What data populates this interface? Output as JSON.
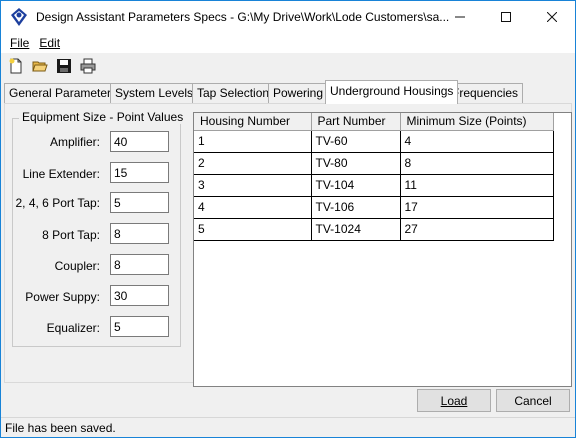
{
  "window": {
    "title": "Design Assistant Parameters Specs - G:\\My Drive\\Work\\Lode Customers\\sa..."
  },
  "menu": {
    "file_label": "File",
    "edit_label": "Edit"
  },
  "toolbar": {
    "icons": [
      "new-file-icon",
      "open-folder-icon",
      "save-disk-icon",
      "print-icon"
    ]
  },
  "tabs": [
    {
      "label": "General Parameters"
    },
    {
      "label": "System Levels"
    },
    {
      "label": "Tap Selection"
    },
    {
      "label": "Powering"
    },
    {
      "label": "Underground Housings"
    },
    {
      "label": "Frequencies"
    }
  ],
  "equipment": {
    "title": "Equipment Size - Point Values",
    "fields": [
      {
        "label": "Amplifier:",
        "value": "40"
      },
      {
        "label": "Line Extender:",
        "value": "15"
      },
      {
        "label": "2, 4, 6 Port Tap:",
        "value": "5"
      },
      {
        "label": "8 Port Tap:",
        "value": "8"
      },
      {
        "label": "Coupler:",
        "value": "8"
      },
      {
        "label": "Power Suppy:",
        "value": "30"
      },
      {
        "label": "Equalizer:",
        "value": "5"
      }
    ]
  },
  "housings": {
    "columns": [
      "Housing Number",
      "Part Number",
      "Minimum Size (Points)"
    ],
    "rows": [
      [
        "1",
        "TV-60",
        "4"
      ],
      [
        "2",
        "TV-80",
        "8"
      ],
      [
        "3",
        "TV-104",
        "11"
      ],
      [
        "4",
        "TV-106",
        "17"
      ],
      [
        "5",
        "TV-1024",
        "27"
      ]
    ]
  },
  "buttons": {
    "load_label": "Load",
    "cancel_label": "Cancel"
  },
  "status": {
    "text": "File has been saved."
  }
}
